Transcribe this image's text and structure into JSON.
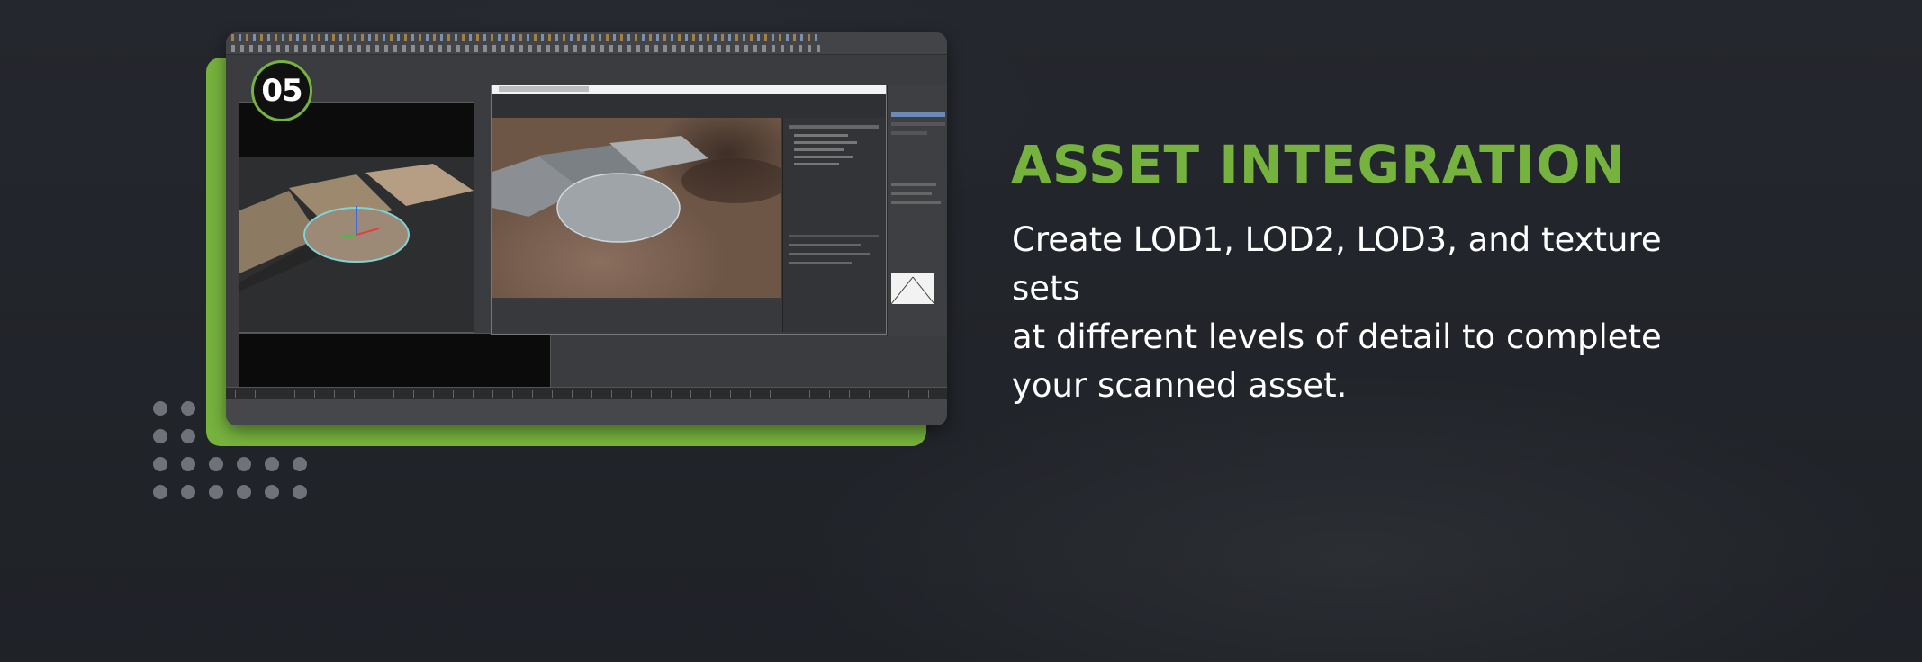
{
  "step": {
    "number": "05"
  },
  "heading": "ASSET INTEGRATION",
  "description_lines": [
    "Create LOD1, LOD2, LOD3, and texture sets",
    "at different levels of detail to complete",
    "your scanned asset."
  ],
  "colors": {
    "background": "#22252b",
    "accent_green": "#76b33e",
    "text": "#ffffff",
    "dots": "#6f7279"
  },
  "screenshot": {
    "description_icon": "3d-software-screenshot"
  }
}
